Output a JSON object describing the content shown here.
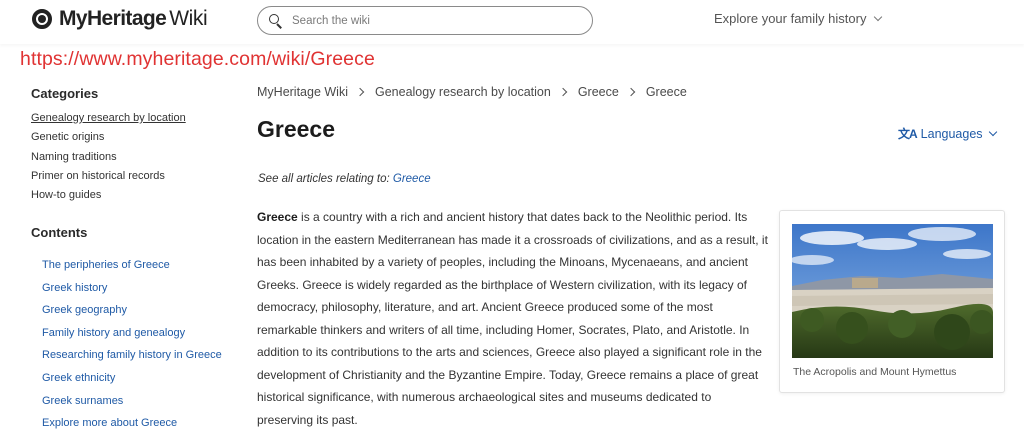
{
  "header": {
    "logo_text": "MyHeritage",
    "logo_suffix": "Wiki",
    "search_placeholder": "Search the wiki",
    "explore_label": "Explore your family history"
  },
  "url_overlay": "https://www.myheritage.com/wiki/Greece",
  "sidebar": {
    "categories_heading": "Categories",
    "categories": [
      "Genealogy research by location",
      "Genetic origins",
      "Naming traditions",
      "Primer on historical records",
      "How-to guides"
    ],
    "contents_heading": "Contents",
    "contents": [
      "The peripheries of Greece",
      "Greek history",
      "Greek geography",
      "Family history and genealogy",
      "Researching family history in Greece",
      "Greek ethnicity",
      "Greek surnames",
      "Explore more about Greece"
    ]
  },
  "breadcrumb": [
    "MyHeritage Wiki",
    "Genealogy research by location",
    "Greece",
    "Greece"
  ],
  "page_title": "Greece",
  "languages": {
    "icon": "translate-icon",
    "label": "Languages"
  },
  "see_all": {
    "prefix": "See all articles relating to:",
    "link": "Greece"
  },
  "article": {
    "bold_lead": "Greece",
    "text": " is a country with a rich and ancient history that dates back to the Neolithic period. Its location in the eastern Mediterranean has made it a crossroads of civilizations, and as a result, it has been inhabited by a variety of peoples, including the Minoans, Mycenaeans, and ancient Greeks. Greece is widely regarded as the birthplace of Western civilization, with its legacy of democracy, philosophy, literature, and art. Ancient Greece produced some of the most remarkable thinkers and writers of all time, including Homer, Socrates, Plato, and Aristotle. In addition to its contributions to the arts and sciences, Greece also played a significant role in the development of Christianity and the Byzantine Empire. Today, Greece remains a place of great historical significance, with numerous archaeological sites and museums dedicated to preserving its past."
  },
  "image_card": {
    "caption": "The Acropolis and Mount Hymettus"
  },
  "colors": {
    "link": "#1f5aa6",
    "url_overlay": "#e03333",
    "text": "#333333"
  }
}
